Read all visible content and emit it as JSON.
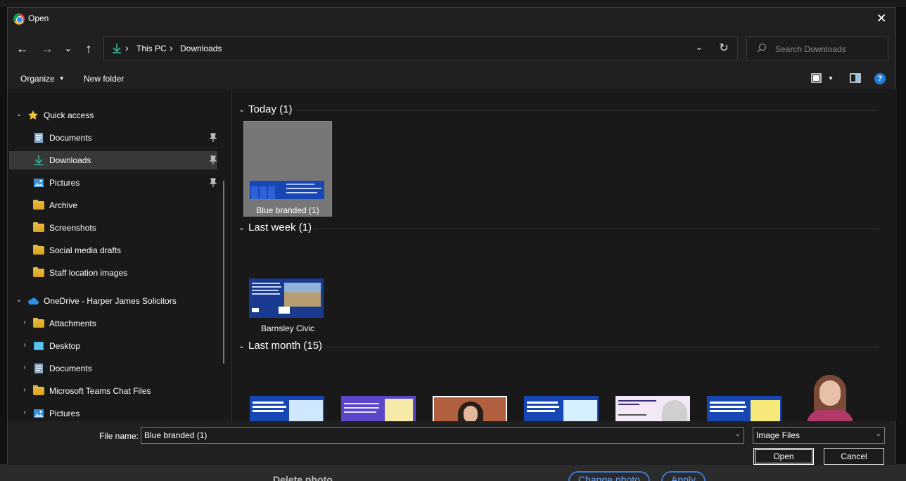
{
  "dialog": {
    "title": "Open",
    "close_label": "✕"
  },
  "navigation": {
    "back_label": "←",
    "forward_label": "→",
    "recent_label": "⌄",
    "up_label": "↑",
    "breadcrumb": [
      "This PC",
      "Downloads"
    ],
    "search_placeholder": "Search Downloads"
  },
  "toolbar": {
    "organize_label": "Organize",
    "new_folder_label": "New folder"
  },
  "sidebar": {
    "quick_access": "Quick access",
    "quick_items": [
      {
        "label": "Documents",
        "icon": "documents-icon",
        "pinned": true
      },
      {
        "label": "Downloads",
        "icon": "downloads-icon",
        "pinned": true,
        "selected": true
      },
      {
        "label": "Pictures",
        "icon": "pictures-icon",
        "pinned": true
      },
      {
        "label": "Archive",
        "icon": "folder-icon"
      },
      {
        "label": "Screenshots",
        "icon": "folder-icon"
      },
      {
        "label": "Social media drafts",
        "icon": "folder-icon"
      },
      {
        "label": "Staff location images",
        "icon": "folder-icon"
      }
    ],
    "onedrive": "OneDrive - Harper James Solicitors",
    "onedrive_items": [
      {
        "label": "Attachments",
        "icon": "folder-icon"
      },
      {
        "label": "Desktop",
        "icon": "desktop-icon"
      },
      {
        "label": "Documents",
        "icon": "documents-icon"
      },
      {
        "label": "Microsoft Teams Chat Files",
        "icon": "folder-icon"
      },
      {
        "label": "Pictures",
        "icon": "pictures-icon"
      }
    ]
  },
  "content": {
    "groups": [
      {
        "title": "Today (1)",
        "files": [
          "Blue branded (1)"
        ]
      },
      {
        "title": "Last week (1)",
        "files": [
          "Barnsley Civic"
        ]
      },
      {
        "title": "Last month (15)",
        "files": []
      }
    ]
  },
  "footer": {
    "file_name_label": "File name:",
    "file_name_value": "Blue branded (1)",
    "file_type": "Image Files",
    "open_label": "Open",
    "cancel_label": "Cancel"
  },
  "background_page": {
    "delete_photo": "Delete photo",
    "change_photo": "Change photo",
    "apply": "Apply"
  },
  "colors": {
    "dialog_bg": "#191919",
    "chrome_bg": "#202020",
    "selection": "#383838",
    "accent_blue": "#1f7ee0",
    "folder_yellow": "#e8b93c"
  }
}
